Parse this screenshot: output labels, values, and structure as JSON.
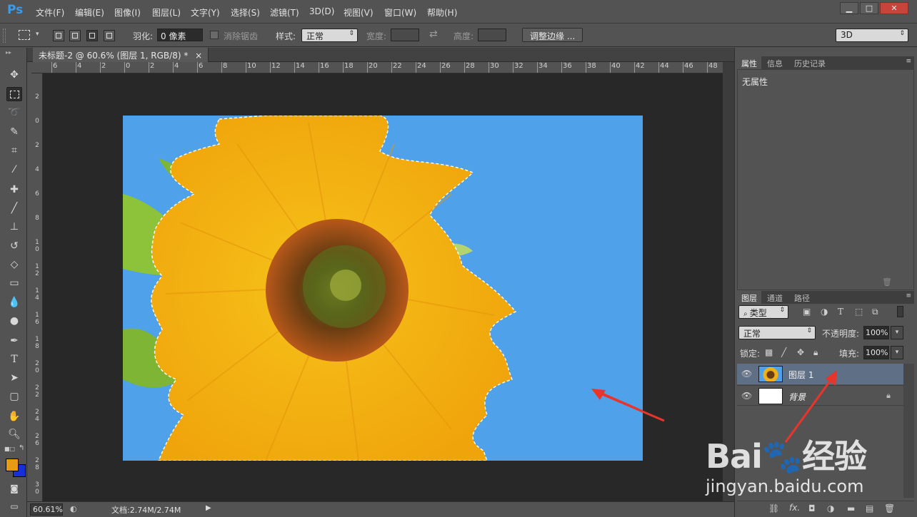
{
  "app": {
    "logo": "Ps"
  },
  "menu": [
    "文件(F)",
    "编辑(E)",
    "图像(I)",
    "图层(L)",
    "文字(Y)",
    "选择(S)",
    "滤镜(T)",
    "3D(D)",
    "视图(V)",
    "窗口(W)",
    "帮助(H)"
  ],
  "window_buttons": {
    "minimize": "▁",
    "maximize": "□",
    "close": "✕"
  },
  "options": {
    "feather_label": "羽化:",
    "feather_value": "0 像素",
    "antialias_label": "消除锯齿",
    "style_label": "样式:",
    "style_value": "正常",
    "width_label": "宽度:",
    "height_label": "高度:",
    "refine_edge_button": "调整边缘 ...",
    "workspace_value": "3D"
  },
  "document": {
    "tab_title": "未标题-2 @ 60.6% (图层 1, RGB/8) *",
    "tab_close": "×",
    "ruler_top_labels": [
      "6",
      "4",
      "2",
      "0",
      "2",
      "4",
      "6",
      "8",
      "10",
      "12",
      "14",
      "16",
      "18",
      "20",
      "22",
      "24",
      "26",
      "28",
      "30",
      "32",
      "34",
      "36",
      "38",
      "40",
      "42",
      "44",
      "46",
      "48"
    ],
    "ruler_left_labels": [
      "2",
      "0",
      "2",
      "4",
      "6",
      "8",
      "10",
      "12",
      "14",
      "16",
      "18",
      "20",
      "22",
      "24",
      "26",
      "28",
      "30"
    ]
  },
  "status": {
    "zoom": "60.61%",
    "doc_info": "文档:2.74M/2.74M"
  },
  "properties_panel": {
    "tabs": [
      "属性",
      "信息",
      "历史记录"
    ],
    "content": "无属性"
  },
  "layers_panel": {
    "tabs": [
      "图层",
      "通道",
      "路径"
    ],
    "filter_kind": "类型",
    "blend_mode": "正常",
    "opacity_label": "不透明度:",
    "opacity_value": "100%",
    "lock_label": "锁定:",
    "fill_label": "填充:",
    "fill_value": "100%",
    "layers": [
      {
        "name": "图层 1",
        "selected": true
      },
      {
        "name": "背景",
        "selected": false,
        "locked": true
      }
    ]
  },
  "watermark": {
    "brand": "Bai🐾经验",
    "url": "jingyan.baidu.com"
  },
  "colors": {
    "foreground": "#e59b14",
    "background": "#1530d8",
    "accent": "#3c9be8",
    "annotation_arrow": "#e8352b"
  }
}
